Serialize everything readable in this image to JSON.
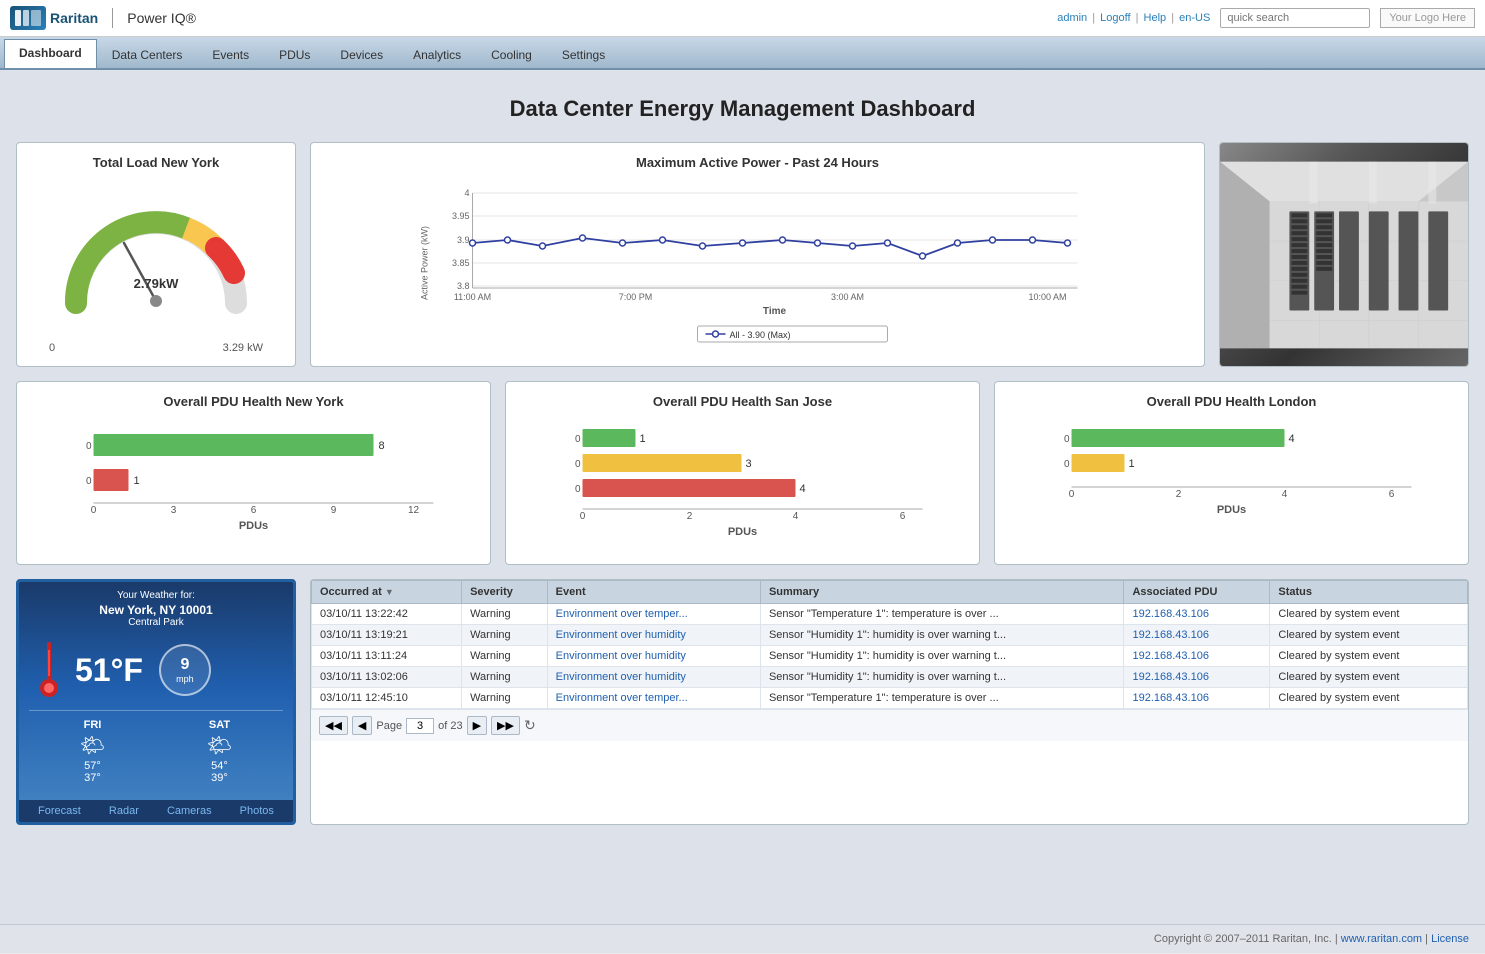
{
  "header": {
    "logo_text": "Raritan",
    "product_name": "Power IQ®",
    "top_links": {
      "admin": "admin",
      "logoff": "Logoff",
      "help": "Help",
      "lang": "en-US"
    },
    "search_placeholder": "quick search",
    "your_logo": "Your Logo Here"
  },
  "nav": {
    "items": [
      {
        "label": "Dashboard",
        "active": true
      },
      {
        "label": "Data Centers",
        "active": false
      },
      {
        "label": "Events",
        "active": false
      },
      {
        "label": "PDUs",
        "active": false
      },
      {
        "label": "Devices",
        "active": false
      },
      {
        "label": "Analytics",
        "active": false
      },
      {
        "label": "Cooling",
        "active": false
      },
      {
        "label": "Settings",
        "active": false
      }
    ]
  },
  "page": {
    "title": "Data Center Energy Management Dashboard"
  },
  "gauge": {
    "title": "Total Load New York",
    "value": "2.79kW",
    "min": "0",
    "max": "3.29 kW"
  },
  "line_chart": {
    "title": "Maximum Active Power - Past 24 Hours",
    "y_axis_label": "Active Power (kW)",
    "x_axis_label": "Time",
    "legend": "All - 3.90 (Max)",
    "x_ticks": [
      "11:00 AM",
      "7:00 PM",
      "3:00 AM",
      "10:00 AM"
    ],
    "y_ticks": [
      "4",
      "3.95",
      "3.9",
      "3.85",
      "3.8"
    ]
  },
  "pdu_charts": [
    {
      "title": "Overall PDU Health New York",
      "bars": [
        {
          "label": "0",
          "value": 8,
          "max": 12,
          "color": "#5cb85c"
        },
        {
          "label": "0",
          "value": 1,
          "max": 12,
          "color": "#d9534f"
        }
      ],
      "x_ticks": [
        "0",
        "3",
        "6",
        "9",
        "12"
      ],
      "bar_values": [
        "8",
        "1"
      ],
      "axis_label": "PDUs"
    },
    {
      "title": "Overall PDU Health San Jose",
      "bars": [
        {
          "label": "0",
          "value": 1,
          "max": 6,
          "color": "#5cb85c"
        },
        {
          "label": "0",
          "value": 3,
          "max": 6,
          "color": "#f0c040"
        },
        {
          "label": "0",
          "value": 4,
          "max": 6,
          "color": "#d9534f"
        }
      ],
      "x_ticks": [
        "0",
        "2",
        "4",
        "6"
      ],
      "bar_values": [
        "1",
        "3",
        "4"
      ],
      "axis_label": "PDUs"
    },
    {
      "title": "Overall PDU Health London",
      "bars": [
        {
          "label": "0",
          "value": 4,
          "max": 6,
          "color": "#5cb85c"
        },
        {
          "label": "0",
          "value": 1,
          "max": 6,
          "color": "#f0c040"
        }
      ],
      "x_ticks": [
        "0",
        "2",
        "4",
        "6"
      ],
      "bar_values": [
        "4",
        "1"
      ],
      "axis_label": "PDUs"
    }
  ],
  "weather": {
    "header": "Your Weather for:",
    "city": "New York, NY 10001",
    "location": "Central Park",
    "temperature": "51°F",
    "wind_speed": "9",
    "wind_unit": "mph",
    "forecast": [
      {
        "day": "FRI",
        "high": "57°",
        "low": "37°",
        "icon": "🌤"
      },
      {
        "day": "SAT",
        "high": "54°",
        "low": "39°",
        "icon": "🌤"
      }
    ],
    "links": [
      "Forecast",
      "Radar",
      "Cameras",
      "Photos"
    ]
  },
  "events_table": {
    "columns": [
      "Occurred at",
      "Severity",
      "Event",
      "Summary",
      "Associated PDU",
      "Status"
    ],
    "rows": [
      {
        "occurred_at": "03/10/11 13:22:42",
        "severity": "Warning",
        "event": "Environment over temper...",
        "summary": "Sensor \"Temperature 1\": temperature is over ...",
        "pdu": "192.168.43.106",
        "status": "Cleared by system event"
      },
      {
        "occurred_at": "03/10/11 13:19:21",
        "severity": "Warning",
        "event": "Environment over humidity",
        "summary": "Sensor \"Humidity 1\": humidity is over warning t...",
        "pdu": "192.168.43.106",
        "status": "Cleared by system event"
      },
      {
        "occurred_at": "03/10/11 13:11:24",
        "severity": "Warning",
        "event": "Environment over humidity",
        "summary": "Sensor \"Humidity 1\": humidity is over warning t...",
        "pdu": "192.168.43.106",
        "status": "Cleared by system event"
      },
      {
        "occurred_at": "03/10/11 13:02:06",
        "severity": "Warning",
        "event": "Environment over humidity",
        "summary": "Sensor \"Humidity 1\": humidity is over warning t...",
        "pdu": "192.168.43.106",
        "status": "Cleared by system event"
      },
      {
        "occurred_at": "03/10/11 12:45:10",
        "severity": "Warning",
        "event": "Environment over temper...",
        "summary": "Sensor \"Temperature 1\": temperature is over ...",
        "pdu": "192.168.43.106",
        "status": "Cleared by system event"
      }
    ],
    "pagination": {
      "page_label": "Page",
      "current_page": "3",
      "total_pages": "23"
    }
  },
  "footer": {
    "text": "Copyright © 2007–2011 Raritan, Inc. |",
    "link1": "www.raritan.com",
    "link2": "License"
  }
}
